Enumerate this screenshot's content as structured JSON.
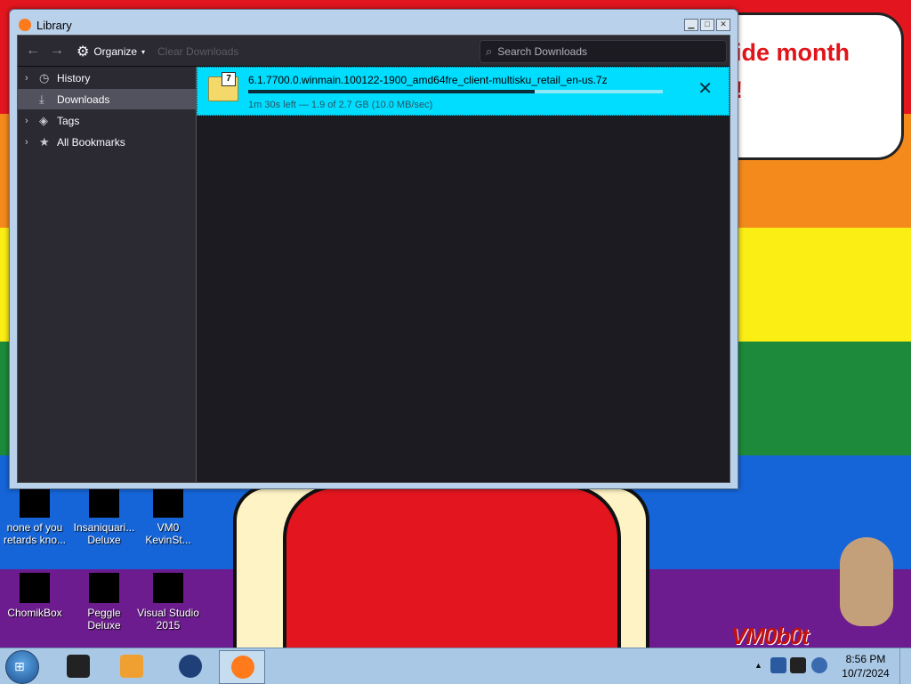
{
  "desktop": {
    "bubble_line1": "ide month",
    "bubble_line2": "!",
    "watermark": "VM0b0t",
    "icons": [
      {
        "label": "none of you retards kno..."
      },
      {
        "label": "Insaniquari... Deluxe"
      },
      {
        "label": "VM0 KevinSt..."
      },
      {
        "label": "ChomikBox"
      },
      {
        "label": "Peggle Deluxe"
      },
      {
        "label": "Visual Studio 2015"
      }
    ]
  },
  "window": {
    "title": "Library",
    "toolbar": {
      "organize_label": "Organize",
      "clear_label": "Clear Downloads",
      "search_placeholder": "Search Downloads"
    },
    "sidebar": {
      "items": [
        {
          "label": "History",
          "icon": "history-icon",
          "expandable": true
        },
        {
          "label": "Downloads",
          "icon": "download-icon",
          "expandable": false,
          "selected": true
        },
        {
          "label": "Tags",
          "icon": "tag-icon",
          "expandable": true
        },
        {
          "label": "All Bookmarks",
          "icon": "star-icon",
          "expandable": true
        }
      ]
    },
    "downloads": [
      {
        "filename": "6.1.7700.0.winmain.100122-1900_amd64fre_client-multisku_retail_en-us.7z",
        "status": "1m 30s left — 1.9 of 2.7 GB (10.0 MB/sec)",
        "progress": 0.69
      }
    ]
  },
  "taskbar": {
    "time": "8:56 PM",
    "date": "10/7/2024"
  },
  "colors": {
    "download_highlight": "#00ddff",
    "sidebar_bg": "#2b2a33",
    "content_bg": "#1c1b22"
  }
}
